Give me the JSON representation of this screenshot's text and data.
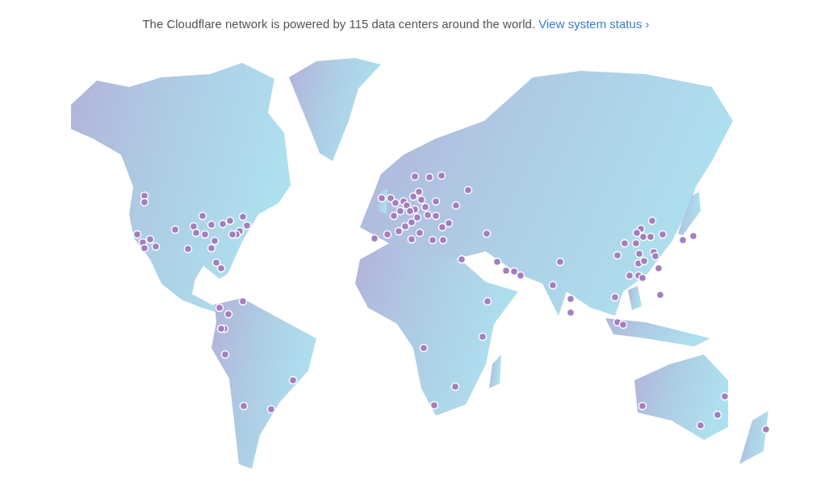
{
  "headline": {
    "text": "The Cloudflare network is powered by 115 data centers around the world.",
    "link": "View system status ›"
  }
}
